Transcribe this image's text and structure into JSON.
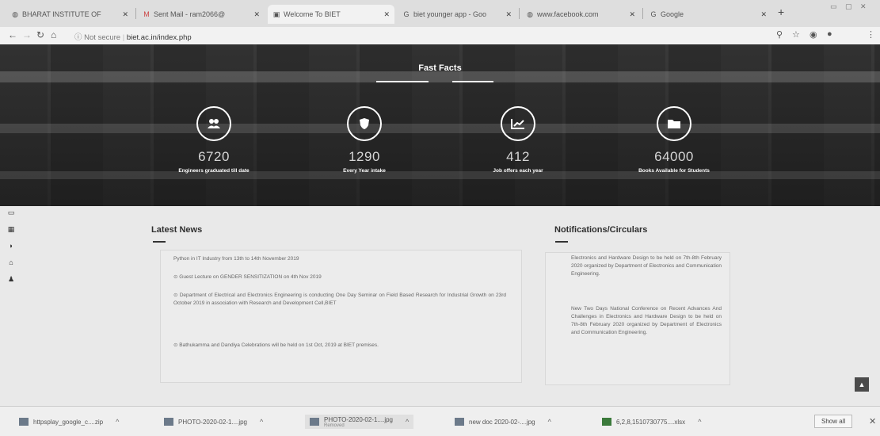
{
  "browser": {
    "tabs": [
      {
        "title": "BHARAT INSTITUTE OF",
        "icon": "globe-icon"
      },
      {
        "title": "Sent Mail - ram2066@",
        "icon": "gmail-icon"
      },
      {
        "title": "Welcome To BIET",
        "icon": "page-icon"
      },
      {
        "title": "biet younger app - Goo",
        "icon": "google-icon"
      },
      {
        "title": "www.facebook.com",
        "icon": "globe-icon"
      },
      {
        "title": "Google",
        "icon": "google-icon"
      }
    ],
    "url_prefix": "Not secure",
    "url": "biet.ac.in/index.php"
  },
  "hero": {
    "title": "Fast Facts",
    "facts": [
      {
        "number": "6720",
        "label": "Engineers graduated till date",
        "icon": "users-icon"
      },
      {
        "number": "1290",
        "label": "Every Year intake",
        "icon": "shield-icon"
      },
      {
        "number": "412",
        "label": "Job offers each year",
        "icon": "chart-icon"
      },
      {
        "number": "64000",
        "label": "Books Available for Students",
        "icon": "folder-icon"
      }
    ]
  },
  "news": {
    "heading": "Latest News",
    "items": [
      "Python in IT Industry from 13th to 14th November 2019",
      "Guest Lecture on GENDER SENSITIZATION on 4th Nov 2019",
      "Department of Electrical and Electronics Engineering is conducting One Day Seminar on Field Based Research for Industrial Growth on 23rd October 2019 in association with Research and Development Cell,BIET",
      "Bathukamma and Dandiya Celebrations will be held on 1st Oct, 2019 at BIET premises."
    ]
  },
  "notifications": {
    "heading": "Notifications/Circulars",
    "items": [
      "Electronics and Hardware Design to be held on 7th-8th February 2020 organized by Department of Electronics and Communication Engineering.",
      "New  Two Days National Conference on Recent Advances And Challenges in Electronics and Hardware Design to be held on 7th-8th February 2020 organized by Department of Electronics and Communication Engineering."
    ]
  },
  "downloads": {
    "items": [
      {
        "name": "httpsplay_google_c....zip",
        "status": ""
      },
      {
        "name": "PHOTO-2020-02-1....jpg",
        "status": ""
      },
      {
        "name": "PHOTO-2020-02-1....jpg",
        "status": "Removed"
      },
      {
        "name": "new doc 2020-02-....jpg",
        "status": ""
      },
      {
        "name": "6,2,8,1510730775....xlsx",
        "status": ""
      }
    ],
    "show_all": "Show all"
  }
}
